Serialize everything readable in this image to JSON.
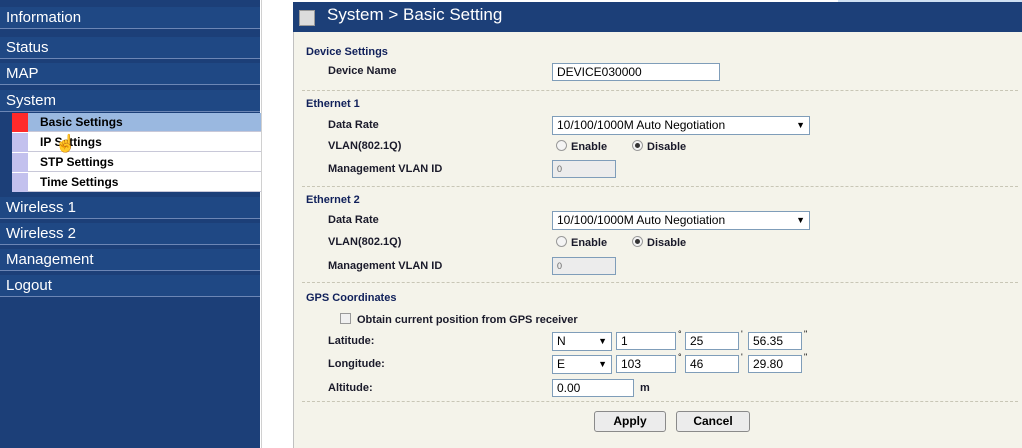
{
  "sidebar": {
    "items": [
      "Information",
      "Status",
      "MAP",
      "System",
      "Wireless 1",
      "Wireless 2",
      "Management",
      "Logout"
    ],
    "submenu": [
      "Basic Settings",
      "IP Settings",
      "STP Settings",
      "Time Settings"
    ]
  },
  "page": {
    "title": "System > Basic Setting"
  },
  "device": {
    "section": "Device Settings",
    "name_label": "Device Name",
    "name_value": "DEVICE030000"
  },
  "eth1": {
    "section": "Ethernet 1",
    "rate_label": "Data Rate",
    "rate_value": "10/100/1000M Auto Negotiation",
    "vlan_label": "VLAN(802.1Q)",
    "enable": "Enable",
    "disable": "Disable",
    "mgmt_label": "Management VLAN ID",
    "mgmt_value": "0"
  },
  "eth2": {
    "section": "Ethernet 2",
    "rate_label": "Data Rate",
    "rate_value": "10/100/1000M Auto Negotiation",
    "vlan_label": "VLAN(802.1Q)",
    "enable": "Enable",
    "disable": "Disable",
    "mgmt_label": "Management VLAN ID",
    "mgmt_value": "0"
  },
  "gps": {
    "section": "GPS Coordinates",
    "obtain_label": "Obtain current position from GPS receiver",
    "lat_label": "Latitude:",
    "lat_dir": "N",
    "lat_deg": "1",
    "lat_min": "25",
    "lat_sec": "56.35",
    "lon_label": "Longitude:",
    "lon_dir": "E",
    "lon_deg": "103",
    "lon_min": "46",
    "lon_sec": "29.80",
    "alt_label": "Altitude:",
    "alt_value": "0.00",
    "alt_unit": "m"
  },
  "buttons": {
    "apply": "Apply",
    "cancel": "Cancel"
  }
}
